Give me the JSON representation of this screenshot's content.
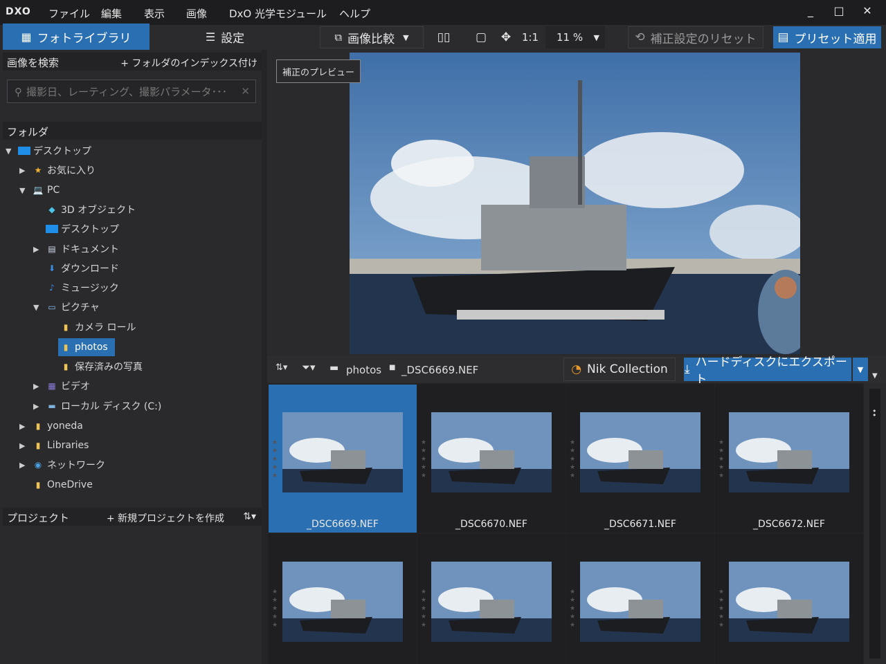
{
  "app": {
    "logo": "DXO"
  },
  "menu": [
    "ファイル",
    "編集",
    "表示",
    "画像",
    "DxO 光学モジュール",
    "ヘルプ"
  ],
  "window_controls": {
    "min": "_",
    "max": "□",
    "close": "✕"
  },
  "tabs": {
    "library": "フォトライブラリ",
    "settings": "設定"
  },
  "toolbar": {
    "compare": "画像比較",
    "one_to_one": "1:1",
    "zoom": "11 %",
    "reset": "補正設定のリセット",
    "apply_preset": "プリセット適用"
  },
  "search": {
    "title": "画像を検索",
    "index_link": "+ フォルダのインデックス付け",
    "placeholder": "撮影日、レーティング、撮影パラメータ･･･"
  },
  "folders": {
    "title": "フォルダ",
    "items": [
      "デスクトップ",
      "お気に入り",
      "PC",
      "3D オブジェクト",
      "デスクトップ",
      "ドキュメント",
      "ダウンロード",
      "ミュージック",
      "ピクチャ",
      "カメラ ロール",
      "photos",
      "保存済みの写真",
      "ビデオ",
      "ローカル ディスク (C:)",
      "yoneda",
      "Libraries",
      "ネットワーク",
      "OneDrive"
    ]
  },
  "projects": {
    "title": "プロジェクト",
    "new": "+ 新規プロジェクトを作成"
  },
  "preview": {
    "badge": "補正のプレビュー"
  },
  "filmstrip": {
    "folder": "photos",
    "file": "_DSC6669.NEF",
    "nik": "Nik Collection",
    "export": "ハードディスクにエクスポート"
  },
  "thumbnails": [
    "_DSC6669.NEF",
    "_DSC6670.NEF",
    "_DSC6671.NEF",
    "_DSC6672.NEF"
  ],
  "colors": {
    "accent": "#2a6fb2",
    "bg": "#2a2a2d",
    "titlebar": "#1d1d1f"
  }
}
